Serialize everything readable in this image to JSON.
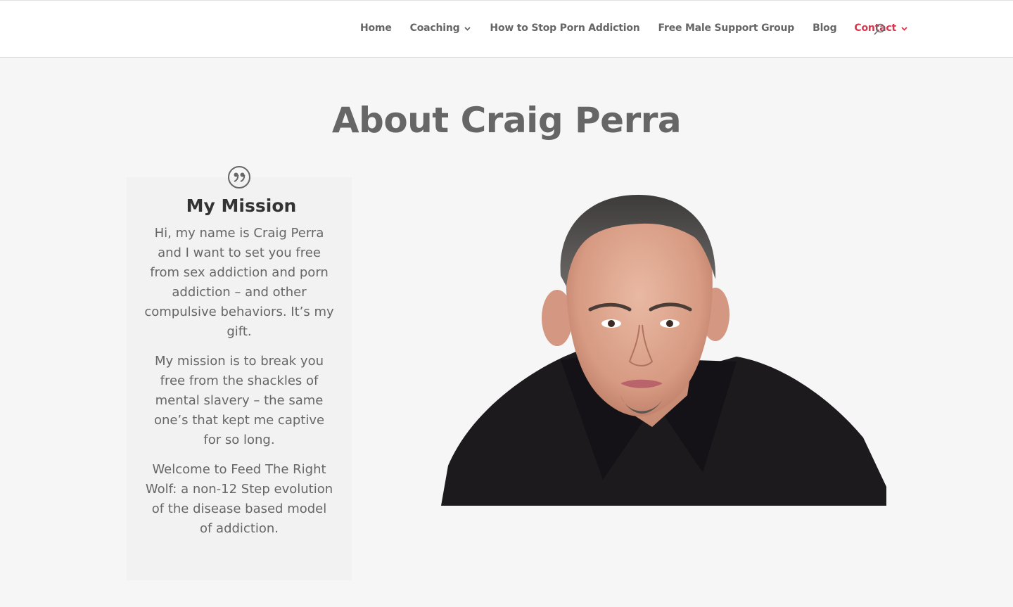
{
  "nav": {
    "items": [
      {
        "label": "Home",
        "has_dropdown": false,
        "active": false
      },
      {
        "label": "Coaching",
        "has_dropdown": true,
        "active": false
      },
      {
        "label": "How to Stop Porn Addiction",
        "has_dropdown": false,
        "active": false
      },
      {
        "label": "Free Male Support Group",
        "has_dropdown": false,
        "active": false
      },
      {
        "label": "Blog",
        "has_dropdown": false,
        "active": false
      },
      {
        "label": "Contact",
        "has_dropdown": true,
        "active": true
      }
    ],
    "search_icon": "search-icon",
    "chevron_icon": "chevron-down-icon"
  },
  "page": {
    "title": "About Craig Perra"
  },
  "mission": {
    "icon": "quote-icon",
    "title": "My Mission",
    "paragraphs": [
      "Hi, my name is Craig Perra and I want to set you free from sex addiction and porn addiction – and other compulsive behaviors. It’s my gift.",
      "My mission is to break you free from the shackles of mental slavery – the same one’s that kept me captive for so long.",
      "Welcome to Feed The Right Wolf: a non-12 Step evolution of the disease based model of addiction."
    ]
  },
  "colors": {
    "accent": "#d9364e",
    "text": "#666666",
    "heading": "#333333",
    "background": "#f6f6f6",
    "card": "#f2f2f2",
    "header": "#ffffff"
  }
}
